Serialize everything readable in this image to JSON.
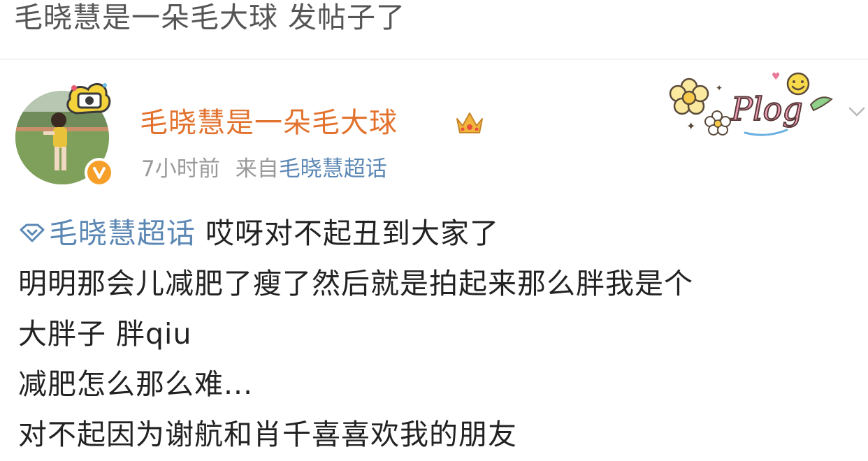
{
  "banner": {
    "title": "毛晓慧是一朵毛大球 发帖子了"
  },
  "post": {
    "username": "毛晓慧是一朵毛大球",
    "time": "7小时前",
    "from_label": "来自",
    "source": "毛晓慧超话",
    "topic_link": "毛晓慧超话",
    "lines": [
      "哎呀对不起丑到大家了",
      "明明那会儿减肥了瘦了然后就是拍起来那么胖我是个",
      "大胖子 胖qiu",
      "减肥怎么那么难...",
      "对不起因为谢航和肖千喜喜欢我的朋友"
    ]
  },
  "sticker": {
    "text": "Plog"
  },
  "colors": {
    "username": "#e2722e",
    "link": "#5b87b4",
    "meta": "#9a9a9a",
    "body_text": "#222222",
    "badge": "#f6a02a"
  },
  "icons": {
    "avatar_frame": "camera-icon",
    "badge": "verified-badge-icon",
    "crown": "crown-icon",
    "topic": "diamond-icon",
    "menu": "chevron-down-icon"
  }
}
